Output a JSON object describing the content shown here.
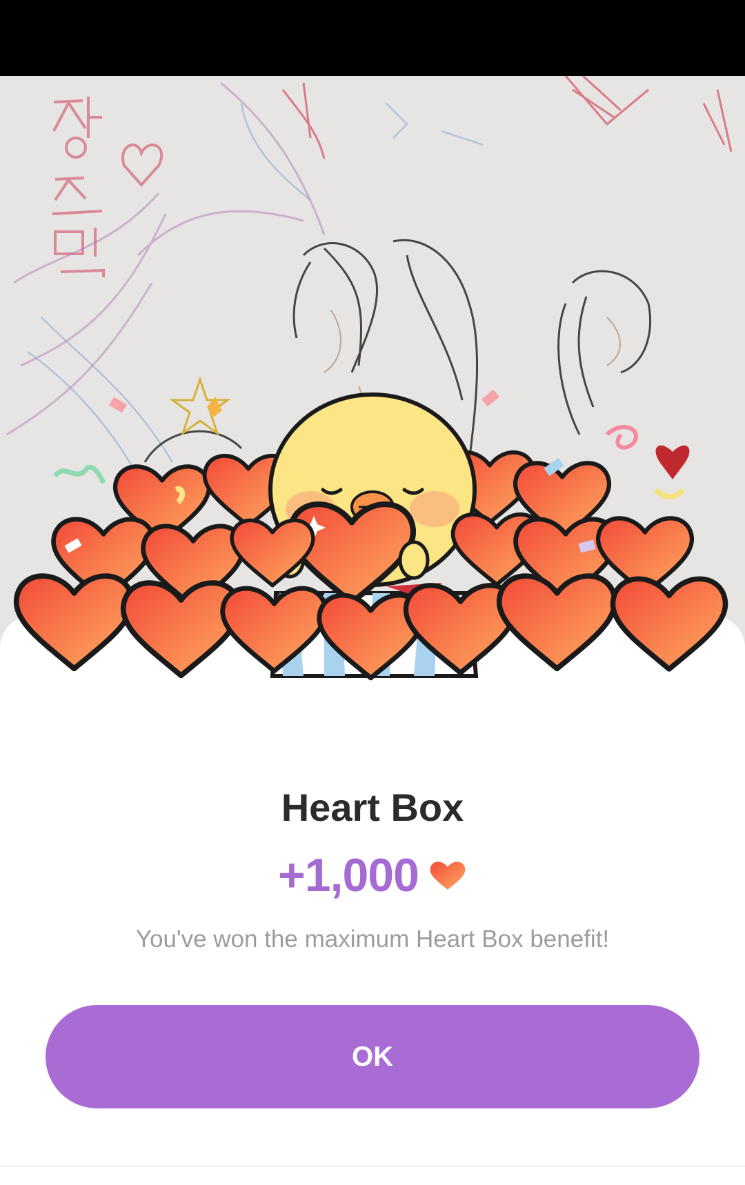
{
  "dialog": {
    "title": "Heart Box",
    "reward_amount": "+1,000",
    "reward_icon": "heart-icon",
    "description": "You've won the maximum Heart Box benefit!",
    "ok_label": "OK"
  },
  "background": {
    "drawing_text": "정소민"
  },
  "colors": {
    "accent_purple": "#a96cd5",
    "reward_purple": "#a46bd3",
    "heart_red": "#f2573f",
    "heart_orange": "#ffa25c",
    "chick_yellow": "#fbe584"
  }
}
